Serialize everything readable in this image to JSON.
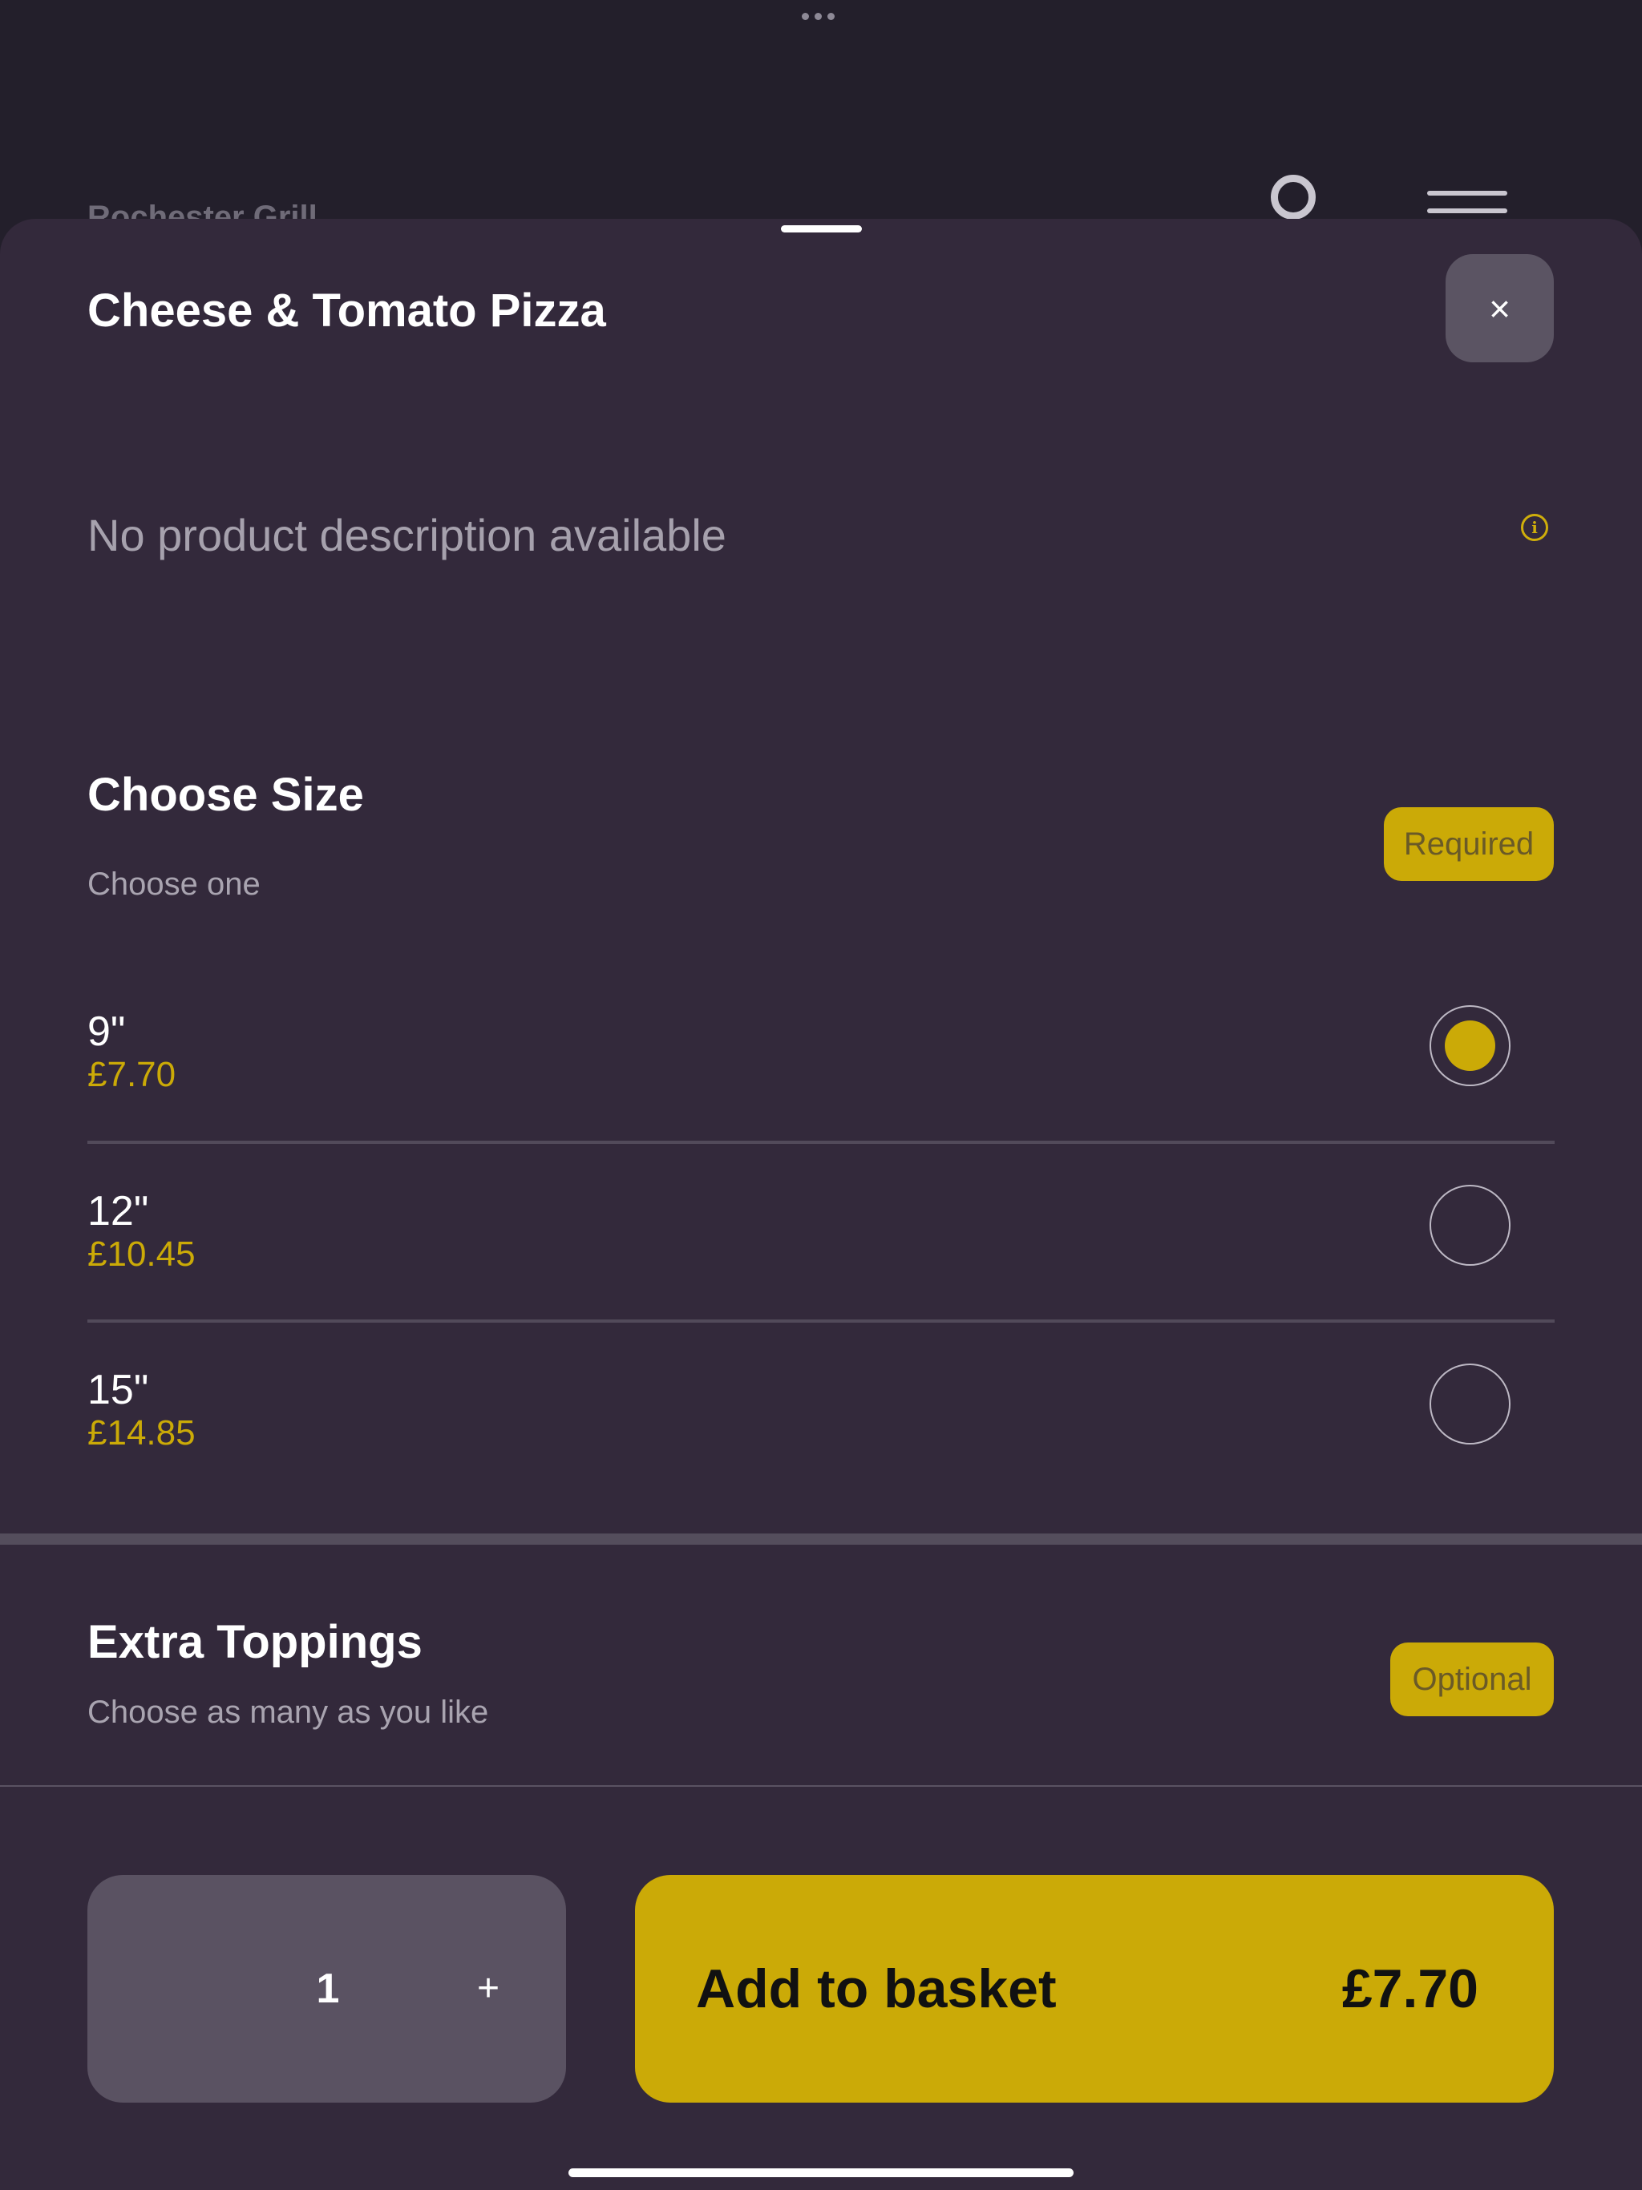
{
  "background": {
    "restaurant_name": "Rochester Grill",
    "search_icon": "search-icon",
    "menu_icon": "hamburger-menu-icon"
  },
  "product": {
    "title": "Cheese & Tomato Pizza",
    "description": "No product description available",
    "close_icon": "×",
    "info_icon": "i"
  },
  "size_section": {
    "title": "Choose Size",
    "subtitle": "Choose one",
    "badge": "Required",
    "options": [
      {
        "size": "9\"",
        "price": "£7.70",
        "selected": true
      },
      {
        "size": "12\"",
        "price": "£10.45",
        "selected": false
      },
      {
        "size": "15\"",
        "price": "£14.85",
        "selected": false
      }
    ]
  },
  "toppings_section": {
    "title": "Extra Toppings",
    "subtitle": "Choose as many as you like",
    "badge": "Optional"
  },
  "footer": {
    "quantity": "1",
    "plus_label": "+",
    "add_label": "Add to basket",
    "total_price": "£7.70"
  },
  "colors": {
    "accent": "#cbaa07",
    "sheet_background": "#33293b",
    "page_background": "#231f2b"
  }
}
